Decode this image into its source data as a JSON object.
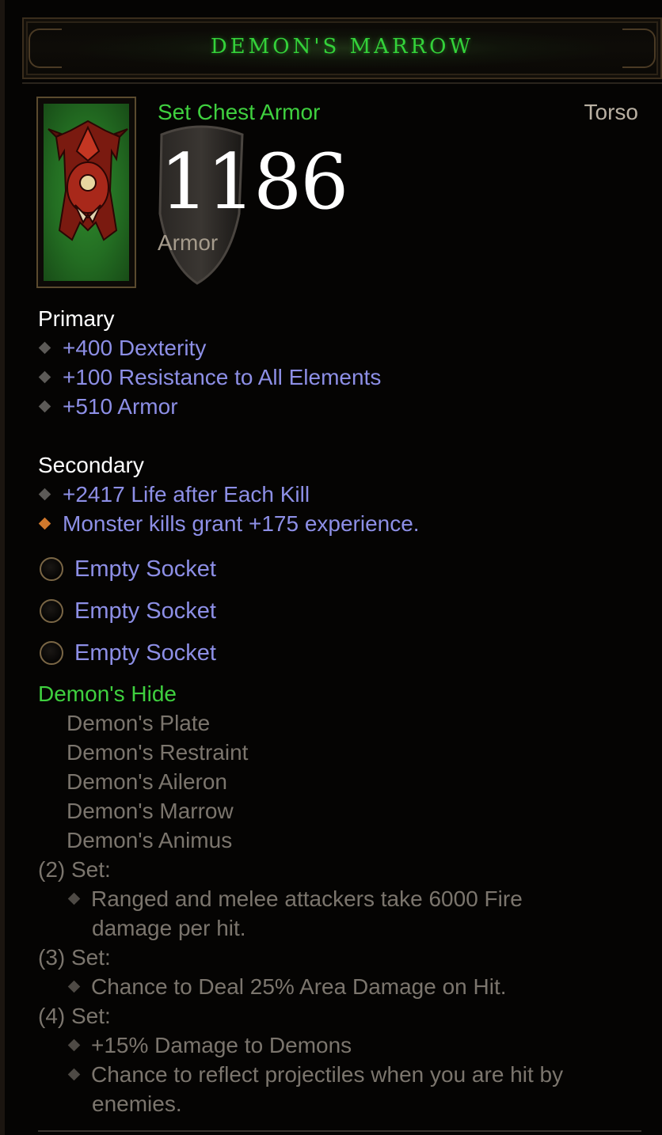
{
  "item": {
    "name": "DEMON'S MARROW",
    "type": "Set Chest Armor",
    "slot": "Torso",
    "armor_value": "1186",
    "armor_label": "Armor"
  },
  "primary": {
    "heading": "Primary",
    "stats": [
      "+400 Dexterity",
      "+100 Resistance to All Elements",
      "+510 Armor"
    ]
  },
  "secondary": {
    "heading": "Secondary",
    "stats": [
      "+2417 Life after Each Kill",
      "Monster kills grant +175 experience."
    ]
  },
  "sockets": [
    "Empty Socket",
    "Empty Socket",
    "Empty Socket"
  ],
  "set": {
    "name": "Demon's Hide",
    "pieces": [
      "Demon's Plate",
      "Demon's Restraint",
      "Demon's Aileron",
      "Demon's Marrow",
      "Demon's Animus"
    ],
    "bonuses": [
      {
        "label": "(2) Set:",
        "lines": [
          [
            "Ranged and melee attackers take 6000 Fire",
            "damage per hit."
          ]
        ]
      },
      {
        "label": "(3) Set:",
        "lines": [
          [
            "Chance to Deal 25% Area Damage on Hit."
          ]
        ]
      },
      {
        "label": "(4) Set:",
        "lines": [
          [
            "+15% Damage to Demons"
          ],
          [
            "Chance to reflect projectiles when you are hit by",
            "enemies."
          ]
        ]
      }
    ]
  },
  "colors": {
    "set_green": "#3fd03f",
    "magic_blue": "#8d8fe6",
    "legendary_orange": "#d0782c",
    "muted_gray": "#7b756d"
  },
  "icons": [
    "chest-armor-icon",
    "shield-watermark-icon",
    "socket-icon",
    "bullet-diamond-icon"
  ]
}
